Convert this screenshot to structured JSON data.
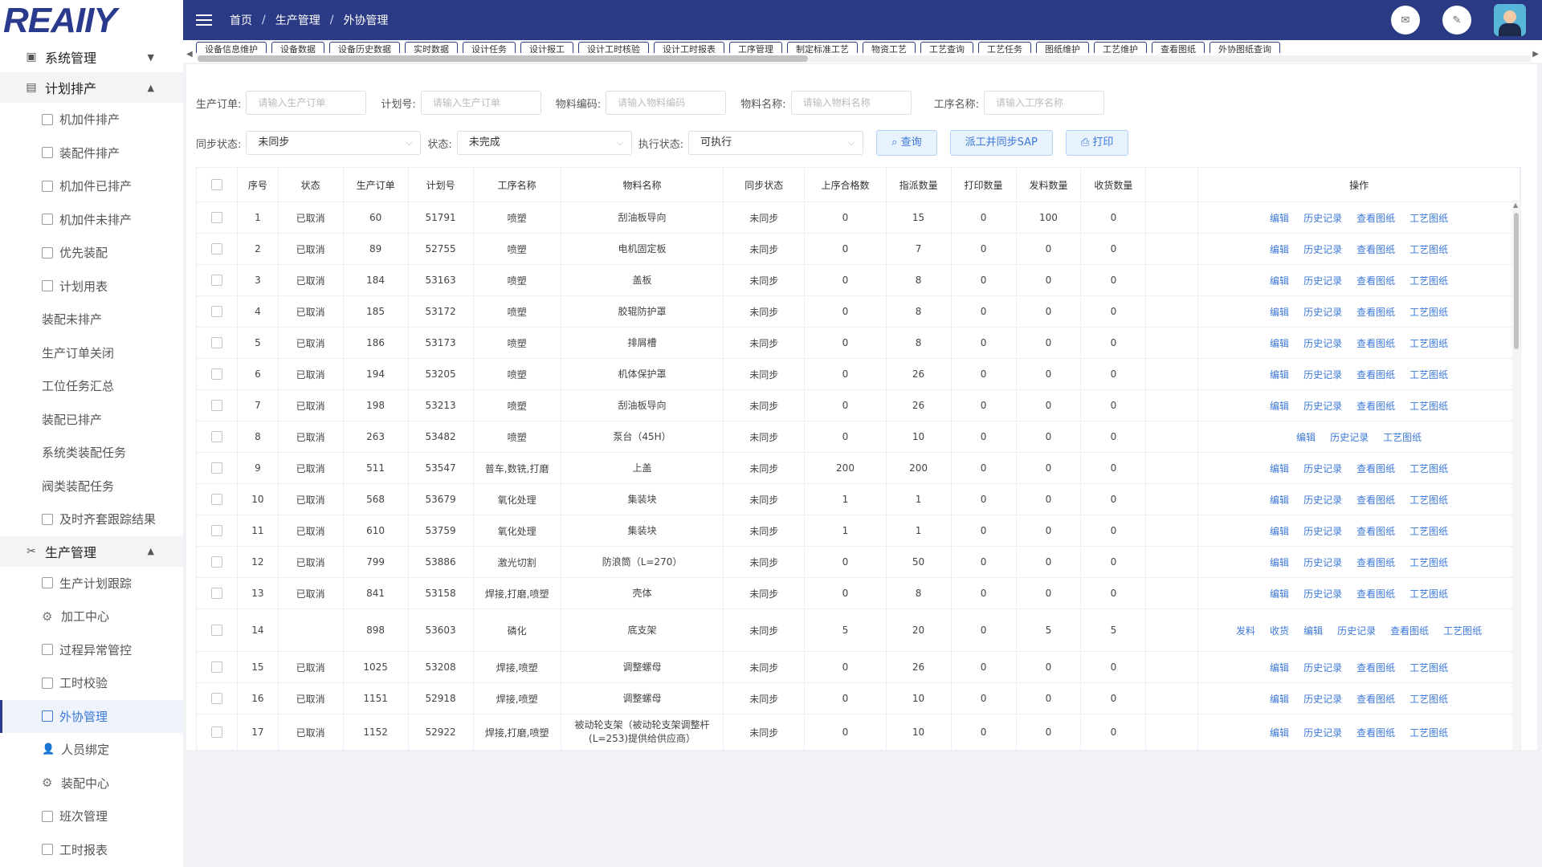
{
  "logo": "REAIIY",
  "sidebar": {
    "groups": [
      {
        "label": "系统管理",
        "arrow": "▼",
        "items": []
      },
      {
        "label": "计划排产",
        "arrow": "▲",
        "items": [
          {
            "label": "机加件排产",
            "icon": "doc"
          },
          {
            "label": "装配件排产",
            "icon": "doc"
          },
          {
            "label": "机加件已排产",
            "icon": "doc"
          },
          {
            "label": "机加件未排产",
            "icon": "doc"
          },
          {
            "label": "优先装配",
            "icon": "doc"
          },
          {
            "label": "计划用表",
            "icon": "doc"
          },
          {
            "label": "装配未排产",
            "icon": "none"
          },
          {
            "label": "生产订单关闭",
            "icon": "none"
          },
          {
            "label": "工位任务汇总",
            "icon": "none"
          },
          {
            "label": "装配已排产",
            "icon": "none"
          },
          {
            "label": "系统类装配任务",
            "icon": "none"
          },
          {
            "label": "阀类装配任务",
            "icon": "none"
          },
          {
            "label": "及时齐套跟踪结果",
            "icon": "doc"
          }
        ]
      },
      {
        "label": "生产管理",
        "arrow": "▲",
        "items": [
          {
            "label": "生产计划跟踪",
            "icon": "doc"
          },
          {
            "label": "加工中心",
            "icon": "gear"
          },
          {
            "label": "过程异常管控",
            "icon": "doc"
          },
          {
            "label": "工时校验",
            "icon": "doc"
          },
          {
            "label": "外协管理",
            "icon": "doc",
            "active": true
          },
          {
            "label": "人员绑定",
            "icon": "person"
          },
          {
            "label": "装配中心",
            "icon": "gear"
          },
          {
            "label": "班次管理",
            "icon": "doc"
          },
          {
            "label": "工时报表",
            "icon": "doc"
          }
        ]
      }
    ]
  },
  "header": {
    "breadcrumb": [
      "首页",
      "生产管理",
      "外协管理"
    ],
    "icons": [
      "mail-icon",
      "edit-icon"
    ]
  },
  "tabs": [
    "设备信息维护",
    "设备数据",
    "设备历史数据",
    "实时数据",
    "设计任务",
    "设计报工",
    "设计工时核验",
    "设计工时报表",
    "工序管理",
    "制定标准工艺",
    "物资工艺",
    "工艺查询",
    "工艺任务",
    "图纸维护",
    "工艺维护",
    "查看图纸",
    "外协图纸查询"
  ],
  "filters": {
    "row1": [
      {
        "label": "生产订单:",
        "placeholder": "请输入生产订单"
      },
      {
        "label": "计划号:",
        "placeholder": "请输入生产订单"
      },
      {
        "label": "物料编码:",
        "placeholder": "请输入物料编码"
      },
      {
        "label": "物料名称:",
        "placeholder": "请输入物料名称"
      },
      {
        "label": "工序名称:",
        "placeholder": "请输入工序名称"
      }
    ],
    "row2": [
      {
        "label": "同步状态:",
        "value": "未同步"
      },
      {
        "label": "状态:",
        "value": "未完成"
      },
      {
        "label": "执行状态:",
        "value": "可执行"
      }
    ],
    "buttons": [
      "查询",
      "派工并同步SAP",
      "打印"
    ]
  },
  "table": {
    "columns": [
      "序号",
      "状态",
      "生产订单",
      "计划号",
      "工序名称",
      "物料名称",
      "同步状态",
      "上序合格数",
      "指派数量",
      "打印数量",
      "发料数量",
      "收货数量",
      "",
      "操作"
    ],
    "rows": [
      {
        "no": "1",
        "status": "已取消",
        "order": "60",
        "plan": "51791",
        "proc": "喷塑",
        "mat": "刮油板导向",
        "sync": "未同步",
        "prev": "0",
        "assign": "15",
        "print": "0",
        "issue": "100",
        "recv": "0",
        "ops": [
          "编辑",
          "历史记录",
          "查看图纸",
          "工艺图纸"
        ]
      },
      {
        "no": "2",
        "status": "已取消",
        "order": "89",
        "plan": "52755",
        "proc": "喷塑",
        "mat": "电机固定板",
        "sync": "未同步",
        "prev": "0",
        "assign": "7",
        "print": "0",
        "issue": "0",
        "recv": "0",
        "ops": [
          "编辑",
          "历史记录",
          "查看图纸",
          "工艺图纸"
        ]
      },
      {
        "no": "3",
        "status": "已取消",
        "order": "184",
        "plan": "53163",
        "proc": "喷塑",
        "mat": "盖板",
        "sync": "未同步",
        "prev": "0",
        "assign": "8",
        "print": "0",
        "issue": "0",
        "recv": "0",
        "ops": [
          "编辑",
          "历史记录",
          "查看图纸",
          "工艺图纸"
        ]
      },
      {
        "no": "4",
        "status": "已取消",
        "order": "185",
        "plan": "53172",
        "proc": "喷塑",
        "mat": "胶辊防护罩",
        "sync": "未同步",
        "prev": "0",
        "assign": "8",
        "print": "0",
        "issue": "0",
        "recv": "0",
        "ops": [
          "编辑",
          "历史记录",
          "查看图纸",
          "工艺图纸"
        ]
      },
      {
        "no": "5",
        "status": "已取消",
        "order": "186",
        "plan": "53173",
        "proc": "喷塑",
        "mat": "排屑槽",
        "sync": "未同步",
        "prev": "0",
        "assign": "8",
        "print": "0",
        "issue": "0",
        "recv": "0",
        "ops": [
          "编辑",
          "历史记录",
          "查看图纸",
          "工艺图纸"
        ]
      },
      {
        "no": "6",
        "status": "已取消",
        "order": "194",
        "plan": "53205",
        "proc": "喷塑",
        "mat": "机体保护罩",
        "sync": "未同步",
        "prev": "0",
        "assign": "26",
        "print": "0",
        "issue": "0",
        "recv": "0",
        "ops": [
          "编辑",
          "历史记录",
          "查看图纸",
          "工艺图纸"
        ]
      },
      {
        "no": "7",
        "status": "已取消",
        "order": "198",
        "plan": "53213",
        "proc": "喷塑",
        "mat": "刮油板导向",
        "sync": "未同步",
        "prev": "0",
        "assign": "26",
        "print": "0",
        "issue": "0",
        "recv": "0",
        "ops": [
          "编辑",
          "历史记录",
          "查看图纸",
          "工艺图纸"
        ]
      },
      {
        "no": "8",
        "status": "已取消",
        "order": "263",
        "plan": "53482",
        "proc": "喷塑",
        "mat": "泵台（45H）",
        "sync": "未同步",
        "prev": "0",
        "assign": "10",
        "print": "0",
        "issue": "0",
        "recv": "0",
        "ops": [
          "编辑",
          "历史记录",
          "工艺图纸"
        ]
      },
      {
        "no": "9",
        "status": "已取消",
        "order": "511",
        "plan": "53547",
        "proc": "普车,数铣,打磨",
        "mat": "上盖",
        "sync": "未同步",
        "prev": "200",
        "assign": "200",
        "print": "0",
        "issue": "0",
        "recv": "0",
        "ops": [
          "编辑",
          "历史记录",
          "查看图纸",
          "工艺图纸"
        ]
      },
      {
        "no": "10",
        "status": "已取消",
        "order": "568",
        "plan": "53679",
        "proc": "氧化处理",
        "mat": "集装块",
        "sync": "未同步",
        "prev": "1",
        "assign": "1",
        "print": "0",
        "issue": "0",
        "recv": "0",
        "ops": [
          "编辑",
          "历史记录",
          "查看图纸",
          "工艺图纸"
        ]
      },
      {
        "no": "11",
        "status": "已取消",
        "order": "610",
        "plan": "53759",
        "proc": "氧化处理",
        "mat": "集装块",
        "sync": "未同步",
        "prev": "1",
        "assign": "1",
        "print": "0",
        "issue": "0",
        "recv": "0",
        "ops": [
          "编辑",
          "历史记录",
          "查看图纸",
          "工艺图纸"
        ]
      },
      {
        "no": "12",
        "status": "已取消",
        "order": "799",
        "plan": "53886",
        "proc": "激光切割",
        "mat": "防浪筒（L=270）",
        "sync": "未同步",
        "prev": "0",
        "assign": "50",
        "print": "0",
        "issue": "0",
        "recv": "0",
        "ops": [
          "编辑",
          "历史记录",
          "查看图纸",
          "工艺图纸"
        ]
      },
      {
        "no": "13",
        "status": "已取消",
        "order": "841",
        "plan": "53158",
        "proc": "焊接,打磨,喷塑",
        "mat": "壳体",
        "sync": "未同步",
        "prev": "0",
        "assign": "8",
        "print": "0",
        "issue": "0",
        "recv": "0",
        "ops": [
          "编辑",
          "历史记录",
          "查看图纸",
          "工艺图纸"
        ]
      },
      {
        "no": "14",
        "status": "",
        "order": "898",
        "plan": "53603",
        "proc": "磷化",
        "mat": "底支架",
        "sync": "未同步",
        "prev": "5",
        "assign": "20",
        "print": "0",
        "issue": "5",
        "recv": "5",
        "ops": [
          "发料",
          "收货",
          "编辑",
          "历史记录",
          "查看图纸",
          "工艺图纸"
        ],
        "tall": true
      },
      {
        "no": "15",
        "status": "已取消",
        "order": "1025",
        "plan": "53208",
        "proc": "焊接,喷塑",
        "mat": "调整螺母",
        "sync": "未同步",
        "prev": "0",
        "assign": "26",
        "print": "0",
        "issue": "0",
        "recv": "0",
        "ops": [
          "编辑",
          "历史记录",
          "查看图纸",
          "工艺图纸"
        ]
      },
      {
        "no": "16",
        "status": "已取消",
        "order": "1151",
        "plan": "52918",
        "proc": "焊接,喷塑",
        "mat": "调整螺母",
        "sync": "未同步",
        "prev": "0",
        "assign": "10",
        "print": "0",
        "issue": "0",
        "recv": "0",
        "ops": [
          "编辑",
          "历史记录",
          "查看图纸",
          "工艺图纸"
        ]
      },
      {
        "no": "17",
        "status": "已取消",
        "order": "1152",
        "plan": "52922",
        "proc": "焊接,打磨,喷塑",
        "mat": "被动轮支架（被动轮支架调整杆(L=253)提供给供应商）",
        "sync": "未同步",
        "prev": "0",
        "assign": "10",
        "print": "0",
        "issue": "0",
        "recv": "0",
        "ops": [
          "编辑",
          "历史记录",
          "查看图纸",
          "工艺图纸"
        ],
        "tall2": true
      }
    ]
  }
}
